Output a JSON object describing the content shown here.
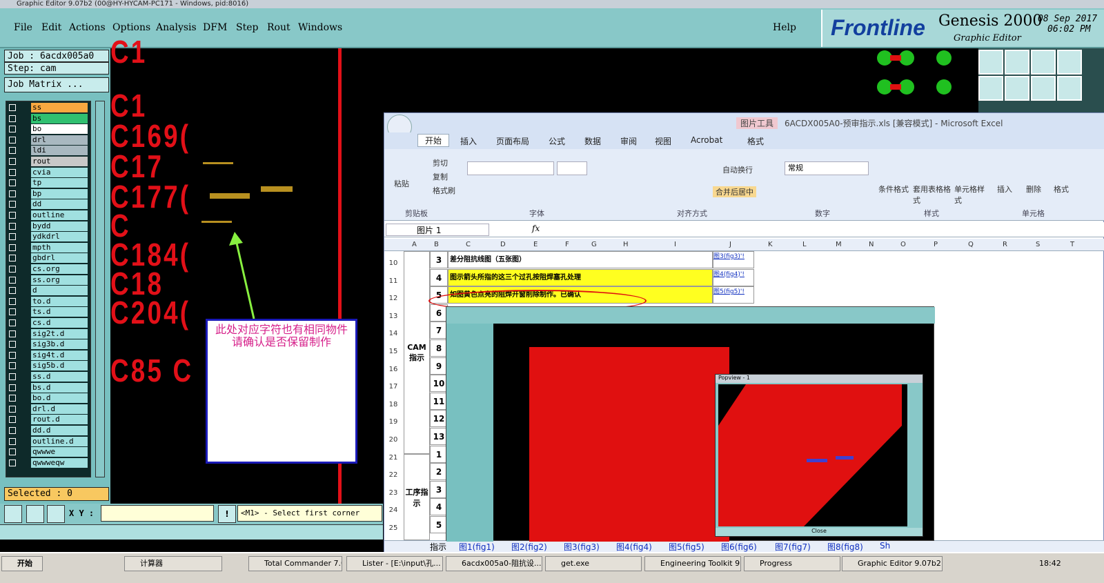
{
  "genesis": {
    "title": "Graphic Editor 9.07b2 (00@HY-HYCAM-PC171 - Windows, pid:8016)",
    "menu": [
      "File",
      "Edit",
      "Actions",
      "Options",
      "Analysis",
      "DFM",
      "Step",
      "Rout",
      "Windows"
    ],
    "help": "Help",
    "brand": {
      "logo": "Frontline",
      "product": "Genesis 2000",
      "subtitle": "Graphic Editor",
      "date": "08 Sep 2017",
      "time": "06:02 PM"
    },
    "job": "Job : 6acdx005a0",
    "step": "Step: cam",
    "job_matrix": "Job Matrix ...",
    "layers": [
      {
        "name": "ss",
        "color": "#f8a840"
      },
      {
        "name": "bs",
        "color": "#30c070"
      },
      {
        "name": "bo",
        "color": "#ffffff"
      },
      {
        "name": "drl",
        "color": "#a8b8c0"
      },
      {
        "name": "ldi",
        "color": "#a8b8c0"
      },
      {
        "name": "rout",
        "color": "#c8c8c8"
      },
      {
        "name": "cvia",
        "color": "#a0e0e0"
      },
      {
        "name": "tp",
        "color": "#a0e0e0"
      },
      {
        "name": "bp",
        "color": "#a0e0e0"
      },
      {
        "name": "dd",
        "color": "#a0e0e0"
      },
      {
        "name": "outline",
        "color": "#a0e0e0"
      },
      {
        "name": "bydd",
        "color": "#a0e0e0"
      },
      {
        "name": "ydkdrl",
        "color": "#a0e0e0"
      },
      {
        "name": "mpth",
        "color": "#a0e0e0"
      },
      {
        "name": "gbdrl",
        "color": "#a0e0e0"
      },
      {
        "name": "cs.org",
        "color": "#a0e0e0"
      },
      {
        "name": "ss.org",
        "color": "#a0e0e0"
      },
      {
        "name": "d",
        "color": "#a0e0e0"
      },
      {
        "name": "to.d",
        "color": "#a0e0e0"
      },
      {
        "name": "ts.d",
        "color": "#a0e0e0"
      },
      {
        "name": "cs.d",
        "color": "#a0e0e0"
      },
      {
        "name": "sig2t.d",
        "color": "#a0e0e0"
      },
      {
        "name": "sig3b.d",
        "color": "#a0e0e0"
      },
      {
        "name": "sig4t.d",
        "color": "#a0e0e0"
      },
      {
        "name": "sig5b.d",
        "color": "#a0e0e0"
      },
      {
        "name": "ss.d",
        "color": "#a0e0e0"
      },
      {
        "name": "bs.d",
        "color": "#a0e0e0"
      },
      {
        "name": "bo.d",
        "color": "#a0e0e0"
      },
      {
        "name": "drl.d",
        "color": "#a0e0e0"
      },
      {
        "name": "rout.d",
        "color": "#a0e0e0"
      },
      {
        "name": "dd.d",
        "color": "#a0e0e0"
      },
      {
        "name": "outline.d",
        "color": "#a0e0e0"
      },
      {
        "name": "qwwwe",
        "color": "#a0e0e0"
      },
      {
        "name": "qwwweqw",
        "color": "#a0e0e0"
      }
    ],
    "selected": "Selected : 0",
    "xy_label": "X Y :",
    "status": "<M1> - Select first corner",
    "canvas_labels": [
      "C1",
      "C169(",
      "C17",
      "C177(",
      "C",
      "C184(",
      "C18",
      "C204(",
      "C85 C"
    ],
    "callout": "此处对应字符也有相同物件  请确认是否保留制作"
  },
  "excel": {
    "quick_access": "图片工具",
    "title": "6ACDX005A0-预审指示.xls [兼容模式] - Microsoft Excel",
    "tabs": [
      "开始",
      "插入",
      "页面布局",
      "公式",
      "数据",
      "审阅",
      "视图",
      "Acrobat",
      "格式"
    ],
    "clipboard": {
      "paste": "粘贴",
      "cut": "剪切",
      "copy": "复制",
      "format": "格式刷",
      "label": "剪贴板"
    },
    "font_label": "字体",
    "align": {
      "wrap": "自动换行",
      "merge": "合并后居中",
      "label": "对齐方式"
    },
    "number": {
      "format": "常规",
      "label": "数字"
    },
    "styles": {
      "cond": "条件格式",
      "table": "套用表格格式",
      "cell": "单元格样式",
      "label": "样式"
    },
    "cells": {
      "insert": "插入",
      "delete": "删除",
      "format": "格式",
      "label": "单元格"
    },
    "name_box": "图片 1",
    "fx": "fx",
    "columns": [
      "A",
      "B",
      "C",
      "D",
      "E",
      "F",
      "G",
      "H",
      "I",
      "J",
      "K",
      "L",
      "M",
      "N",
      "O",
      "P",
      "Q",
      "R",
      "S",
      "T"
    ],
    "rows": [
      {
        "r": "10",
        "n": "3",
        "text": "差分阻抗线图（五张图）",
        "link": "图3(fig3)'!"
      },
      {
        "r": "11",
        "n": "4",
        "text": "图示箭头所指的这三个过孔按阻焊塞孔处理",
        "link": "图4(fig4)'!"
      },
      {
        "r": "12",
        "n": "5",
        "text": "如图黄色点亮的阻焊开窗削除制作。已确认",
        "link": "图5(fig5)'!"
      },
      {
        "r": "13",
        "n": "6",
        "text": "",
        "link": ""
      },
      {
        "r": "14",
        "n": "7",
        "text": "",
        "link": ""
      },
      {
        "r": "15",
        "n": "8",
        "text": "",
        "link": ""
      },
      {
        "r": "16",
        "n": "9",
        "text": "",
        "link": ""
      },
      {
        "r": "17",
        "n": "10",
        "text": "",
        "link": ""
      },
      {
        "r": "18",
        "n": "11",
        "text": "",
        "link": ""
      },
      {
        "r": "19",
        "n": "12",
        "text": "",
        "link": ""
      },
      {
        "r": "20",
        "n": "13",
        "text": "",
        "link": ""
      },
      {
        "r": "21",
        "n": "1",
        "text": "",
        "link": ""
      },
      {
        "r": "22",
        "n": "2",
        "text": "",
        "link": ""
      },
      {
        "r": "23",
        "n": "3",
        "text": "",
        "link": ""
      },
      {
        "r": "24",
        "n": "4",
        "text": "",
        "link": ""
      },
      {
        "r": "25",
        "n": "5",
        "text": "",
        "link": ""
      }
    ],
    "group_a": "CAM指示",
    "group_b": "工序指示",
    "sheets": [
      "指示",
      "图1(fig1)",
      "图2(fig2)",
      "图3(fig3)",
      "图4(fig4)",
      "图5(fig5)",
      "图6(fig6)",
      "图7(fig7)",
      "图8(fig8)",
      "Sh"
    ],
    "popview_title": "Popview - 1",
    "popview_close": "Close"
  },
  "taskbar": {
    "start": "开始",
    "items": [
      "计算器",
      "Total Commander 7.0...",
      "Lister - [E:\\input\\孔...",
      "6acdx005a0-阻抗设...",
      "get.exe",
      "Engineering Toolkit 9....",
      "Progress",
      "Graphic Editor 9.07b2..."
    ],
    "clock": "18:42"
  }
}
